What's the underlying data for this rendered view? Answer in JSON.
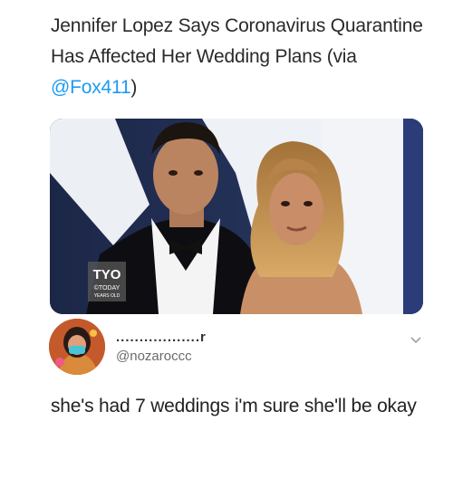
{
  "post": {
    "headline_text": "Jennifer Lopez Says Coronavirus Quarantine Has Affected Her Wedding Plans (via ",
    "headline_mention": "@Fox411",
    "headline_close": ")",
    "image_watermark": {
      "logo": "TYO",
      "line1": "©TODAY",
      "line2": "YEARS OLD"
    }
  },
  "reply": {
    "display_name": "..................r",
    "handle": "@nozaroccc",
    "text": "she's had 7 weddings i'm sure she'll be okay"
  },
  "colors": {
    "mention": "#1d9bf0",
    "background": "#ffffff"
  },
  "icons": {
    "menu": "chevron-down-icon"
  }
}
